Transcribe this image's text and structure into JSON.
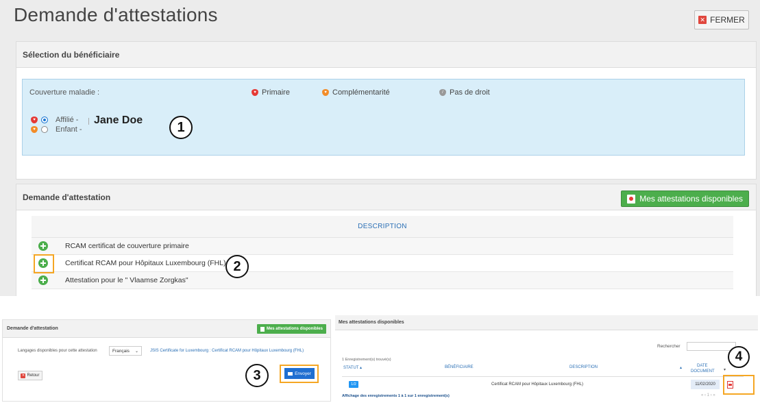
{
  "main": {
    "title": "Demande d'attestations",
    "close_label": "FERMER",
    "beneficiary_panel": {
      "heading": "Sélection du bénéficiaire",
      "coverage_label": "Couverture maladie :",
      "legend": {
        "primary": "Primaire",
        "complementary": "Complémentarité",
        "none": "Pas de droit"
      },
      "affiliate_label": "Affilié -",
      "child_label": "Enfant -",
      "selected_name": "Jane Doe"
    },
    "request_panel": {
      "heading": "Demande d'attestation",
      "available_button": "Mes attestations disponibles",
      "column_header": "DESCRIPTION",
      "rows": [
        "RCAM certificat de couverture primaire",
        "Certificat RCAM pour Hôpitaux Luxembourg (FHL)",
        "Attestation pour le \" Vlaamse Zorgkas\""
      ]
    }
  },
  "steps": [
    "1",
    "2",
    "3",
    "4"
  ],
  "step3_panel": {
    "heading": "Demande d'attestation",
    "available_button": "Mes attestations disponibles",
    "languages_label": "Langages disponibles pour cette attestation",
    "language_value": "Français",
    "certificate_link": "JSIS Certificate for Luxembourg : Certificat RCAM pour Hôpitaux Luxembourg (FHL)",
    "back_label": "Retour",
    "send_label": "Envoyer"
  },
  "step4_panel": {
    "heading": "Mes attestations disponibles",
    "search_label": "Rechercher",
    "record_count": "1 Enregistrement(s) trouvé(s)",
    "columns": {
      "status": "STATUT",
      "beneficiary": "BÉNÉFICIAIRE",
      "description": "DESCRIPTION",
      "date_line1": "DATE",
      "date_line2": "DOCUMENT"
    },
    "row": {
      "status": "1/2",
      "description": "Certificat RCAM pour Hôpitaux Luxembourg (FHL)",
      "date": "11/02/2020"
    },
    "footer": "Affichage des enregistrements 1 à 1 sur 1 enregistrement(s)",
    "pager": "« ‹ 1 › »"
  },
  "colors": {
    "accent_green": "#4cae4c",
    "highlight_orange": "#f5a623",
    "info_blue_bg": "#d9eef9",
    "primary_blue": "#1f6fd1",
    "danger_red": "#e0463d"
  }
}
